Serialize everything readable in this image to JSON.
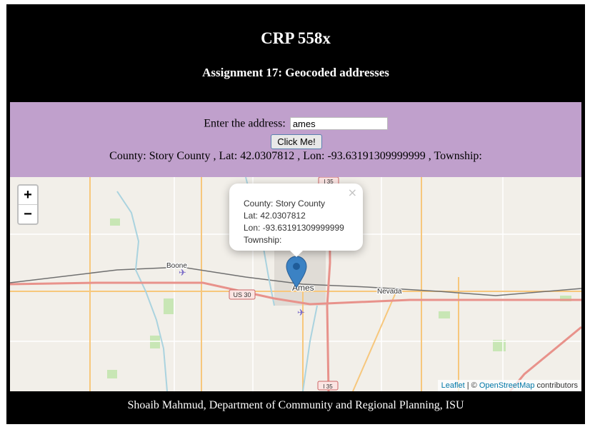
{
  "header": {
    "title": "CRP 558x",
    "subtitle": "Assignment 17: Geocoded addresses"
  },
  "form": {
    "address_label": "Enter the address:",
    "address_value": "ames",
    "button_label": "Click Me!",
    "result_text": "County: Story County , Lat: 42.0307812 , Lon: -93.63191309999999 , Township:"
  },
  "map": {
    "zoom_in": "+",
    "zoom_out": "−",
    "popup": {
      "close": "×",
      "county": "County: Story County",
      "lat": "Lat: 42.0307812",
      "lon": "Lon: -93.63191309999999",
      "township": "Township:"
    },
    "places": {
      "boone": "Boone",
      "ames": "Ames",
      "nevada": "Nevada"
    },
    "shields": {
      "i35_top": "I 35",
      "us30": "US 30",
      "i35_bottom": "I 35"
    },
    "attribution": {
      "leaflet": "Leaflet",
      "sep": " | © ",
      "osm": "OpenStreetMap",
      "contributors": " contributors"
    },
    "colors": {
      "background": "#f2efe9",
      "highway": "#e8928b",
      "secondary_road": "#f7c77c",
      "river": "#aad3df",
      "park": "#c8e6b5",
      "marker": "#3b82c4"
    }
  },
  "footer": {
    "text": "Shoaib Mahmud, Department of Community and Regional Planning, ISU"
  }
}
